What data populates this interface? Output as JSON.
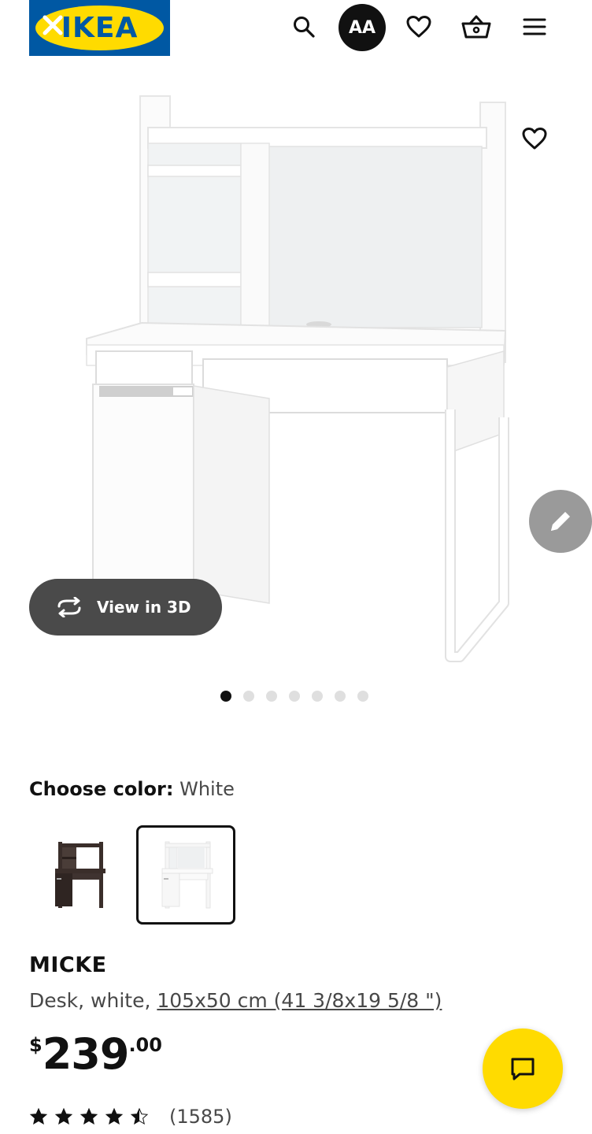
{
  "header": {
    "logo_text": "IKEA",
    "avatar_initials": "AA",
    "icons": [
      "close-icon",
      "search-icon",
      "heart-icon",
      "basket-icon",
      "menu-icon"
    ]
  },
  "gallery": {
    "view_3d_label": "View in 3D",
    "image_count": 7,
    "active_index": 0
  },
  "color_choice": {
    "label": "Choose color:",
    "selected": "White",
    "swatches": [
      "brown-black-desk-thumbnail",
      "white-desk-thumbnail"
    ]
  },
  "product": {
    "name": "MICKE",
    "description": "Desk, white,",
    "size_link": "105x50 cm (41 3/8x19 5/8 \")",
    "price_currency": "$",
    "price_integer": "239",
    "price_decimal": ".00",
    "rating_value": 4.5,
    "rating_count": "(1585)"
  },
  "colors": {
    "ikea_blue": "#0058a3",
    "ikea_yellow": "#ffdb00",
    "text_primary": "#111111",
    "text_secondary": "#484848"
  }
}
